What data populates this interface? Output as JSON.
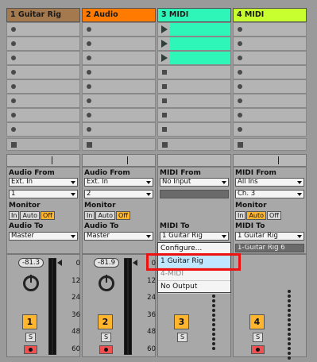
{
  "tracks": [
    {
      "id": "1",
      "name": "1 Guitar Rig",
      "color": "#a4794e",
      "type": "audio",
      "slots": [
        "dot",
        "dot",
        "dot",
        "dot",
        "dot",
        "dot",
        "dot",
        "dot"
      ],
      "io": {
        "from_label": "Audio From",
        "from": "Ext. In",
        "channel": "1",
        "monitor_label": "Monitor",
        "monitor": [
          "In",
          "Auto",
          "Off"
        ],
        "monitor_active": "Off",
        "to_label": "Audio To",
        "to": "Master"
      },
      "volume": "-81.3",
      "number": "1",
      "solo": "S",
      "scale": [
        "0",
        "12",
        "24",
        "36",
        "48",
        "60"
      ]
    },
    {
      "id": "2",
      "name": "2 Audio",
      "color": "#ff7a00",
      "type": "audio",
      "slots": [
        "dot",
        "dot",
        "dot",
        "dot",
        "dot",
        "dot",
        "dot",
        "dot"
      ],
      "io": {
        "from_label": "Audio From",
        "from": "Ext. In",
        "channel": "2",
        "monitor_label": "Monitor",
        "monitor": [
          "In",
          "Auto",
          "Off"
        ],
        "monitor_active": "Off",
        "to_label": "Audio To",
        "to": "Master"
      },
      "volume": "-81.9",
      "number": "2",
      "solo": "S",
      "scale": [
        "0",
        "12",
        "24",
        "36",
        "48",
        "60"
      ]
    },
    {
      "id": "3",
      "name": "3 MIDI",
      "color": "#2ef5b8",
      "type": "midi",
      "slots": [
        "clip",
        "clip",
        "clip",
        "square",
        "square",
        "square",
        "square",
        "square"
      ],
      "io": {
        "from_label": "MIDI From",
        "from": "No Input",
        "to_label": "MIDI To",
        "to": "1 Guitar Rig"
      },
      "number": "3",
      "solo": "S"
    },
    {
      "id": "4",
      "name": "4 MIDI",
      "color": "#c8ff2e",
      "type": "midi",
      "slots": [
        "dot",
        "dot",
        "dot",
        "dot",
        "dot",
        "dot",
        "dot",
        "dot"
      ],
      "io": {
        "from_label": "MIDI From",
        "from": "All Ins",
        "channel": "Ch. 3",
        "monitor_label": "Monitor",
        "monitor": [
          "In",
          "Auto",
          "Off"
        ],
        "monitor_active": "Auto",
        "to_label": "MIDI To",
        "to": "1 Guitar Rig",
        "to_sub": "1-Guitar Rig 6"
      },
      "number": "4",
      "solo": "S"
    }
  ],
  "dropdown": {
    "items": [
      "Configure...",
      "1 Guitar Rig",
      "4-MIDI",
      "No Output"
    ],
    "highlighted": "1 Guitar Rig"
  },
  "colors": {
    "orange": "#ffb52e",
    "arm": "#f25050",
    "clip": "#2ef5b8"
  }
}
